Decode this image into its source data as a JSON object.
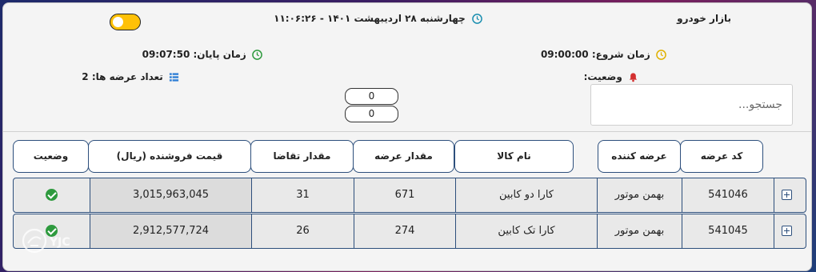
{
  "header": {
    "market_title": "بازار خودرو",
    "datetime": "چهارشنبه ۲۸ اردیبهشت ۱۴۰۱ - ۱۱:۰۶:۲۶",
    "theme_toggle_on": true
  },
  "info": {
    "start_time_label": "زمان شروع:",
    "start_time_value": "09:00:00",
    "end_time_label": "زمان پایان:",
    "end_time_value": "09:07:50",
    "status_label": "وضعیت:",
    "offer_count_label": "تعداد عرضه ها:",
    "offer_count_value": "2"
  },
  "counters": [
    "0",
    "0"
  ],
  "search": {
    "placeholder": "جستجو..."
  },
  "table": {
    "headers": {
      "offer_code": "کد عرضه",
      "supplier": "عرضه کننده",
      "product": "نام کالا",
      "supply_qty": "مقدار عرضه",
      "demand_qty": "مقدار تقاضا",
      "sale_price": "قیمت فروشنده (ریال)",
      "status": "وضعیت"
    },
    "rows": [
      {
        "offer_code": "541046",
        "supplier": "بهمن موتور",
        "product": "کارا دو کابین",
        "supply_qty": "671",
        "demand_qty": "31",
        "sale_price": "3,015,963,045",
        "status": "ok"
      },
      {
        "offer_code": "541045",
        "supplier": "بهمن موتور",
        "product": "کارا تک کابین",
        "supply_qty": "274",
        "demand_qty": "26",
        "sale_price": "2,912,577,724",
        "status": "ok"
      }
    ]
  },
  "watermark": {
    "text": "YJC"
  },
  "colors": {
    "border": "#2d4f7c",
    "toggle": "#ffc107",
    "success": "#2e9a3e",
    "clock_icon": "#2e9a3e",
    "start_clock_icon": "#e0b100",
    "bell_icon": "#d32f2f",
    "list_icon": "#2f7fd6"
  }
}
